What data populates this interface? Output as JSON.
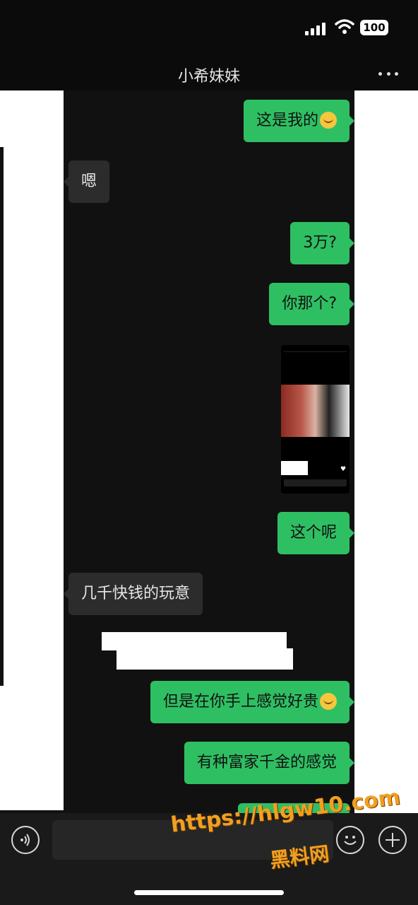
{
  "status_bar": {
    "battery": "100"
  },
  "header": {
    "title": "小希妹妹"
  },
  "messages": [
    {
      "side": "me",
      "text": "这是我的",
      "emoji": "laughing-emoji"
    },
    {
      "side": "other",
      "text": "嗯"
    },
    {
      "side": "me",
      "text": "3万?"
    },
    {
      "side": "me",
      "text": "你那个?"
    },
    {
      "side": "me",
      "type": "image"
    },
    {
      "side": "me",
      "text": "这个呢"
    },
    {
      "side": "other",
      "text": "几千快钱的玩意"
    },
    {
      "side": "me",
      "text": "但是在你手上感觉好贵",
      "emoji": "laughing-emoji"
    },
    {
      "side": "me",
      "text": "有种富家千金的感觉"
    }
  ],
  "watermark": {
    "url": "https://hlgw10.com",
    "name": "黑料网"
  },
  "colors": {
    "my_bubble": "#2fbf63",
    "other_bubble": "#2c2c2c",
    "background": "#111111"
  }
}
